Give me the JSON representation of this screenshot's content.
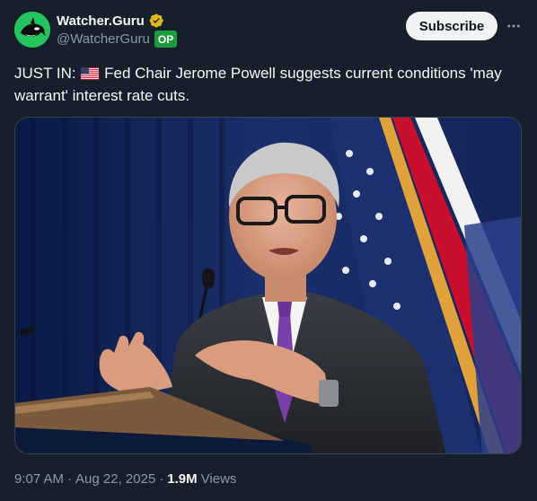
{
  "author": {
    "display_name": "Watcher.Guru",
    "handle": "@WatcherGuru",
    "op_badge": "OP",
    "verified_color": "#e2b719"
  },
  "actions": {
    "subscribe_label": "Subscribe",
    "more_icon": "ellipsis-icon"
  },
  "post": {
    "prefix": "JUST IN:",
    "flag_icon": "us-flag-icon",
    "text": "Fed Chair Jerome Powell suggests current conditions 'may warrant' interest rate cuts.",
    "media_description_icon": "photo-icon"
  },
  "footer": {
    "time": "9:07 AM",
    "date": "Aug 22, 2025",
    "views_count": "1.9M",
    "views_label": "Views",
    "separator": "·"
  },
  "colors": {
    "background": "#15202b",
    "primary_text": "#f7f9f9",
    "secondary_text": "#8b98a5",
    "op_green": "#1d9b3f",
    "avatar_green": "#22c55e"
  }
}
